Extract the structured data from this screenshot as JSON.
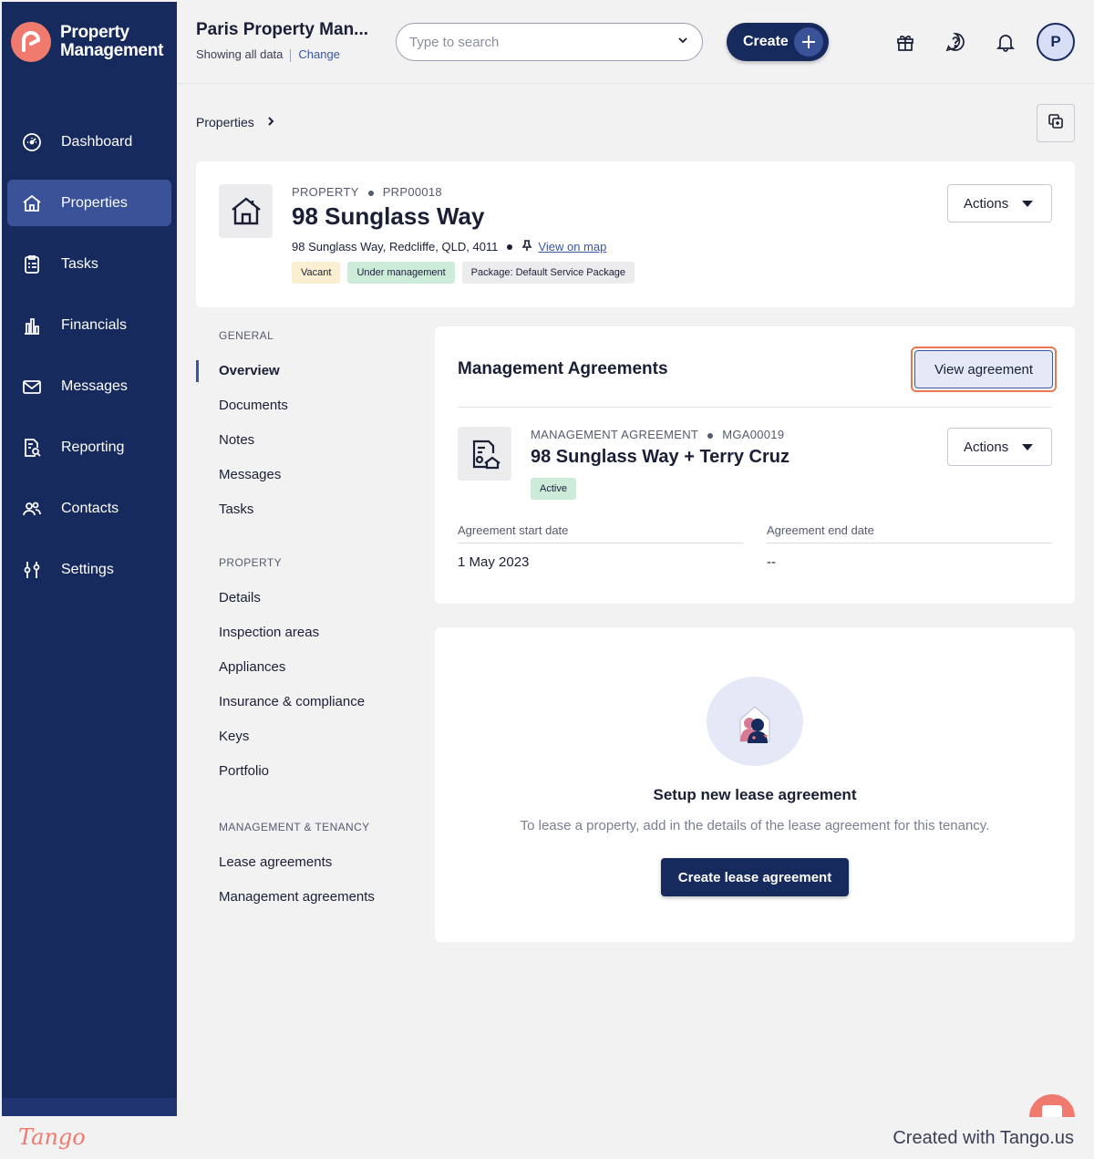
{
  "brand": {
    "name_line1": "Property",
    "name_line2": "Management"
  },
  "sidebar": {
    "items": [
      {
        "label": "Dashboard",
        "icon": "dashboard-icon"
      },
      {
        "label": "Properties",
        "icon": "home-icon",
        "active": true
      },
      {
        "label": "Tasks",
        "icon": "tasks-icon"
      },
      {
        "label": "Financials",
        "icon": "financials-icon"
      },
      {
        "label": "Messages",
        "icon": "mail-icon"
      },
      {
        "label": "Reporting",
        "icon": "reporting-icon"
      },
      {
        "label": "Contacts",
        "icon": "contacts-icon"
      },
      {
        "label": "Settings",
        "icon": "settings-icon"
      }
    ]
  },
  "header": {
    "org_name": "Paris Property Man...",
    "org_sub": "Showing all data",
    "change_label": "Change",
    "search_placeholder": "Type to search",
    "create_label": "Create",
    "avatar_initial": "P"
  },
  "breadcrumb": {
    "item": "Properties"
  },
  "property": {
    "type_label": "PROPERTY",
    "id": "PRP00018",
    "title": "98 Sunglass Way",
    "address": "98 Sunglass Way, Redcliffe, QLD, 4011",
    "map_link": "View on map",
    "actions_label": "Actions",
    "badges": [
      {
        "label": "Vacant",
        "color": "#fbefd2"
      },
      {
        "label": "Under management",
        "color": "#cdebd9"
      },
      {
        "label": "Package: Default Service Package",
        "color": "#ececef"
      }
    ]
  },
  "subnav": {
    "general_heading": "GENERAL",
    "general": [
      "Overview",
      "Documents",
      "Notes",
      "Messages",
      "Tasks"
    ],
    "property_heading": "PROPERTY",
    "property": [
      "Details",
      "Inspection areas",
      "Appliances",
      "Insurance & compliance",
      "Keys",
      "Portfolio"
    ],
    "mgmt_heading": "MANAGEMENT & TENANCY",
    "mgmt": [
      "Lease agreements",
      "Management agreements"
    ]
  },
  "management": {
    "title": "Management Agreements",
    "view_label": "View agreement",
    "type_label": "MANAGEMENT AGREEMENT",
    "id": "MGA00019",
    "name": "98 Sunglass Way + Terry Cruz",
    "status": "Active",
    "actions_label": "Actions",
    "start_label": "Agreement start date",
    "start_value": "1 May 2023",
    "end_label": "Agreement end date",
    "end_value": "--"
  },
  "lease": {
    "title": "Setup new lease agreement",
    "description": "To lease a property, add in the details of the lease agreement for this tenancy.",
    "button_label": "Create lease agreement"
  },
  "footer": {
    "logo": "Tango",
    "credit": "Created with Tango.us"
  },
  "colors": {
    "sidebar": "#172a5e",
    "active": "#3a5298",
    "accent": "#3b55a6",
    "brand": "#f07a6e"
  }
}
